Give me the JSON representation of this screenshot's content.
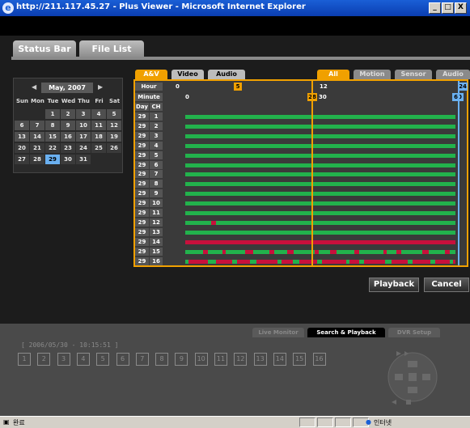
{
  "window": {
    "title": "http://211.117.45.27 - Plus Viewer - Microsoft Internet Explorer",
    "controls": [
      "_",
      "□",
      "X"
    ]
  },
  "top_tabs": [
    "Status Bar",
    "File List"
  ],
  "calendar": {
    "month_label": "May, 2007",
    "weekdays": [
      "Sun",
      "Mon",
      "Tue",
      "Wed",
      "Thu",
      "Fri",
      "Sat"
    ],
    "weeks": [
      [
        "",
        "",
        "1",
        "2",
        "3",
        "4",
        "5"
      ],
      [
        "6",
        "7",
        "8",
        "9",
        "10",
        "11",
        "12"
      ],
      [
        "13",
        "14",
        "15",
        "16",
        "17",
        "18",
        "19"
      ],
      [
        "20",
        "21",
        "22",
        "23",
        "24",
        "25",
        "26"
      ],
      [
        "27",
        "28",
        "29",
        "30",
        "31",
        "",
        ""
      ]
    ],
    "selected_day": "29"
  },
  "type_tabs": [
    "A&V",
    "Video",
    "Audio"
  ],
  "event_tabs": [
    "All",
    "Motion",
    "Sensor",
    "Audio"
  ],
  "timeline": {
    "hour_label": "Hour",
    "minute_label": "Minute",
    "hour_marks": [
      "0",
      "5",
      "12",
      "24"
    ],
    "minute_marks": [
      "0",
      "28",
      "30",
      "60"
    ],
    "day_col": "Day",
    "ch_col": "CH"
  },
  "rows": [
    {
      "day": "29",
      "ch": "1"
    },
    {
      "day": "29",
      "ch": "2"
    },
    {
      "day": "29",
      "ch": "3"
    },
    {
      "day": "29",
      "ch": "4"
    },
    {
      "day": "29",
      "ch": "5"
    },
    {
      "day": "29",
      "ch": "6"
    },
    {
      "day": "29",
      "ch": "7"
    },
    {
      "day": "29",
      "ch": "8"
    },
    {
      "day": "29",
      "ch": "9"
    },
    {
      "day": "29",
      "ch": "10"
    },
    {
      "day": "29",
      "ch": "11"
    },
    {
      "day": "29",
      "ch": "12"
    },
    {
      "day": "29",
      "ch": "13"
    },
    {
      "day": "29",
      "ch": "14"
    },
    {
      "day": "29",
      "ch": "15"
    },
    {
      "day": "29",
      "ch": "16"
    }
  ],
  "buttons": {
    "playback": "Playback",
    "cancel": "Cancel"
  },
  "bottom_tabs": [
    "Live Monitor",
    "Search & Playback",
    "DVR Setup"
  ],
  "datetime": "[ 2006/05/30 - 10:15:51 ]",
  "channels": [
    "1",
    "2",
    "3",
    "4",
    "5",
    "6",
    "7",
    "8",
    "9",
    "10",
    "11",
    "12",
    "13",
    "14",
    "15",
    "16"
  ],
  "status": {
    "left": "완료",
    "right": "인터넷"
  },
  "colors": {
    "accent": "#f0a000",
    "record_green": "#22b24c",
    "record_red": "#c8103c",
    "cursor_blue": "#6ab0f0"
  }
}
